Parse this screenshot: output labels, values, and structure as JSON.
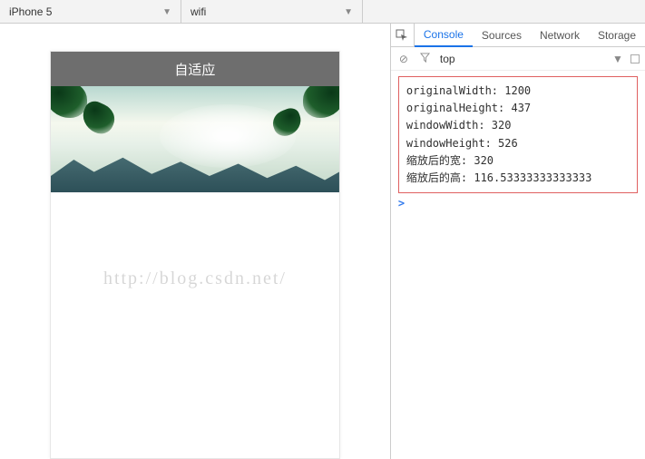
{
  "toolbar": {
    "device": "iPhone 5",
    "network": "wifi"
  },
  "phone": {
    "title": "自适应"
  },
  "devtools": {
    "tabs": {
      "console": "Console",
      "sources": "Sources",
      "network": "Network",
      "storage": "Storage"
    },
    "filter_scope": "top"
  },
  "console": {
    "logs": [
      "originalWidth: 1200",
      "originalHeight: 437",
      "windowWidth: 320",
      "windowHeight: 526",
      "缩放后的宽: 320",
      "缩放后的高: 116.53333333333333"
    ],
    "prompt": ">"
  },
  "watermark": "http://blog.csdn.net/"
}
